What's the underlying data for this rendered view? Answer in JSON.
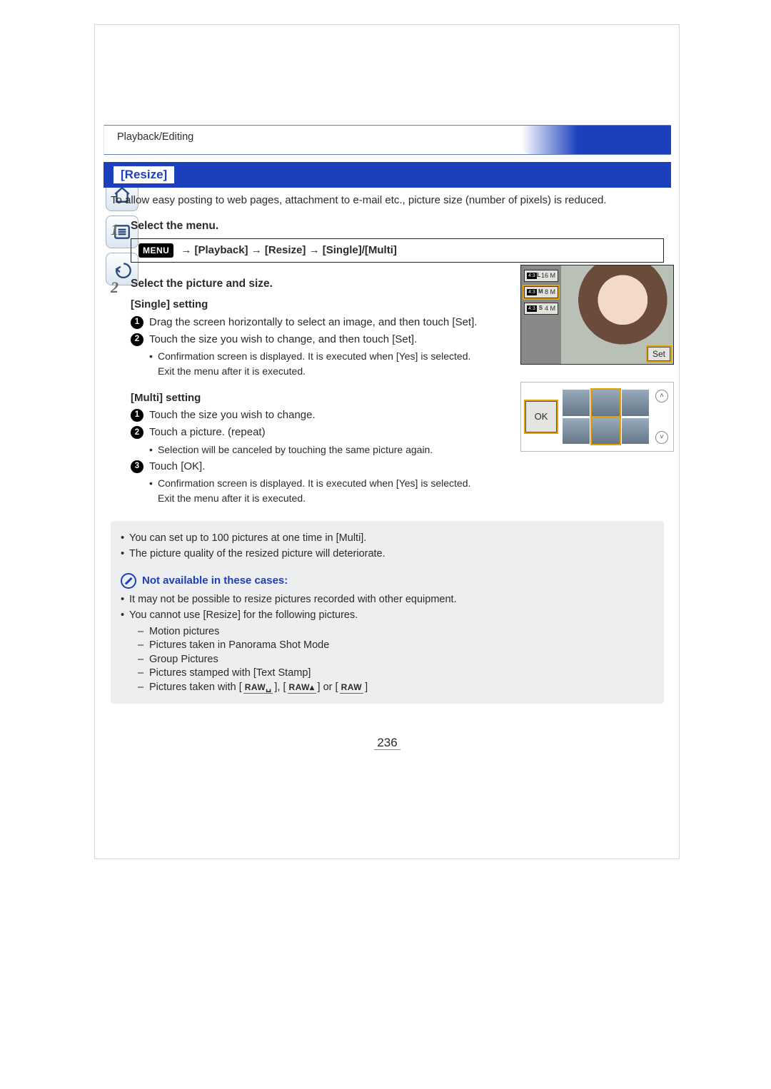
{
  "breadcrumb": "Playback/Editing",
  "section_title": "[Resize]",
  "intro": "To allow easy posting to web pages, attachment to e-mail etc., picture size (number of pixels) is reduced.",
  "steps": {
    "s1": {
      "num": "1",
      "title": "Select the menu.",
      "menu_badge": "MENU",
      "menu_path": "→   [Playback] → [Resize] → [Single]/[Multi]"
    },
    "s2": {
      "num": "2",
      "title": "Select the picture and size.",
      "single_head": "[Single] setting",
      "single_1": "Drag the screen horizontally to select an image, and then touch [Set].",
      "single_2": "Touch the size you wish to change, and then touch [Set].",
      "single_2_sub": "Confirmation screen is displayed. It is executed when [Yes] is selected.",
      "single_2_sub2": "Exit the menu after it is executed.",
      "multi_head": "[Multi] setting",
      "multi_1": "Touch the size you wish to change.",
      "multi_2": "Touch a picture. (repeat)",
      "multi_2_sub": "Selection will be canceled by touching the same picture again.",
      "multi_3": "Touch [OK].",
      "multi_3_sub": "Confirmation screen is displayed. It is executed when [Yes] is selected.",
      "multi_3_sub2": "Exit the menu after it is executed."
    }
  },
  "shots": {
    "size1": "16 M",
    "size2": "8 M",
    "size3": "4 M",
    "ar": "4:3",
    "set_label": "Set",
    "ok_label": "OK"
  },
  "notes": {
    "n1": "You can set up to 100 pictures at one time in [Multi].",
    "n2": "The picture quality of the resized picture will deteriorate.",
    "na_title": "Not available in these cases:",
    "na1": "It may not be possible to resize pictures recorded with other equipment.",
    "na2": "You cannot use [Resize] for the following pictures.",
    "na2a": "Motion pictures",
    "na2b": "Pictures taken in Panorama Shot Mode",
    "na2c": "Group Pictures",
    "na2d": "Pictures stamped with [Text Stamp]",
    "na2e_prefix": "Pictures taken with ",
    "raw1": "RAW␣",
    "raw2": "RAW▴",
    "raw3": "RAW",
    "na2e_mid1": ", ",
    "na2e_mid2": " or "
  },
  "page_number": "236"
}
